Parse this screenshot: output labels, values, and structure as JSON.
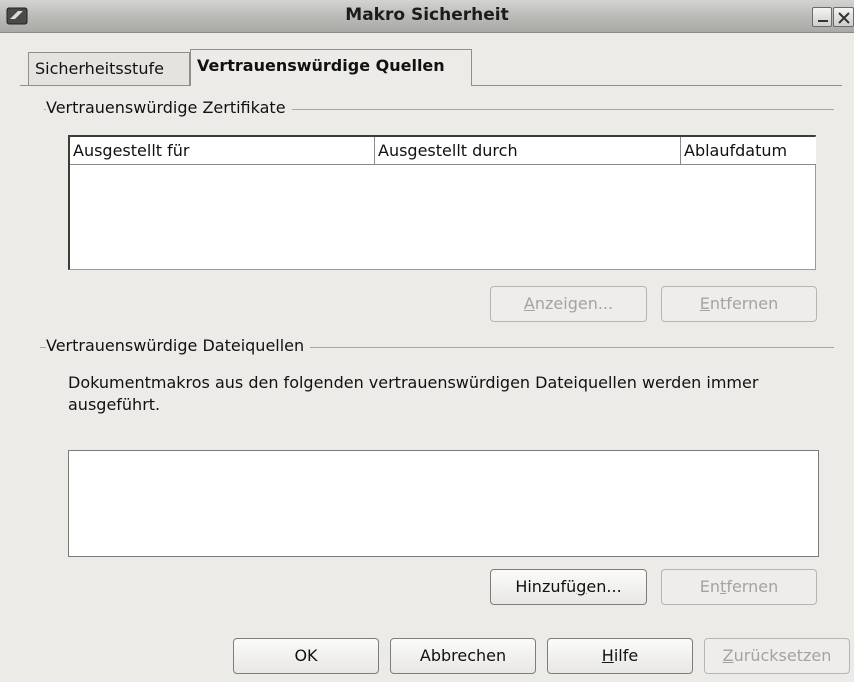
{
  "window": {
    "title": "Makro Sicherheit"
  },
  "tabs": [
    {
      "label": "Sicherheitsstufe",
      "active": false
    },
    {
      "label": "Vertrauenswürdige Quellen",
      "active": true
    }
  ],
  "certificates": {
    "group_label": "Vertrauenswürdige Zertifikate",
    "columns": [
      "Ausgestellt für",
      "Ausgestellt durch",
      "Ablaufdatum"
    ],
    "rows": [],
    "buttons": [
      {
        "label": "Anzeigen...",
        "mnemonic": "A",
        "enabled": false
      },
      {
        "label": "Entfernen",
        "mnemonic": "E",
        "enabled": false
      }
    ]
  },
  "file_sources": {
    "group_label": "Vertrauenswürdige Dateiquellen",
    "description": "Dokumentmakros aus den folgenden vertrauenswürdigen Dateiquellen werden immer ausgeführt.",
    "items": [],
    "buttons": [
      {
        "label": "Hinzufügen...",
        "mnemonic": "g",
        "enabled": true
      },
      {
        "label": "Entfernen",
        "mnemonic": "t",
        "enabled": false
      }
    ]
  },
  "footer_buttons": [
    {
      "label": "OK",
      "enabled": true
    },
    {
      "label": "Abbrechen",
      "enabled": true
    },
    {
      "label": "Hilfe",
      "mnemonic": "H",
      "enabled": true
    },
    {
      "label": "Zurücksetzen",
      "mnemonic": "Z",
      "enabled": false
    }
  ]
}
